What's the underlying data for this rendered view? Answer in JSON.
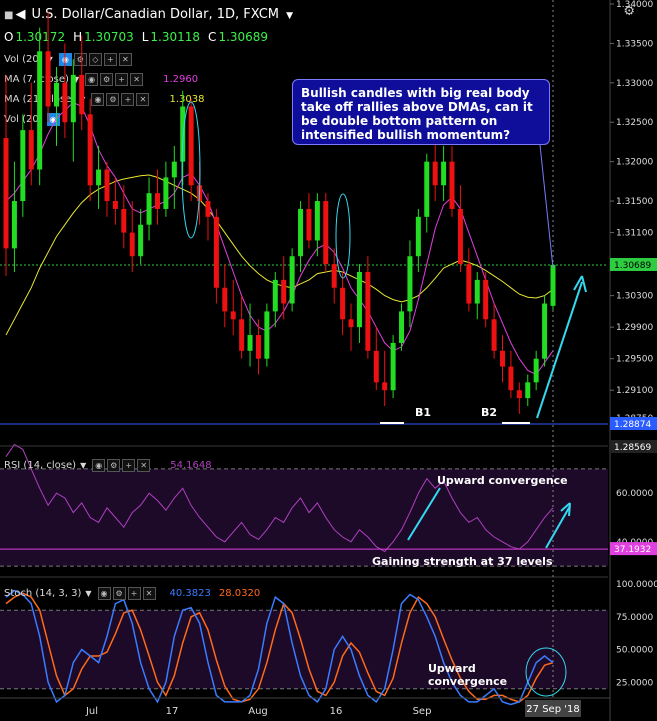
{
  "header": {
    "title": "U.S. Dollar/Canadian Dollar, 1D, FXCM",
    "ohlc": [
      {
        "k": "O",
        "v": "1.30172"
      },
      {
        "k": "H",
        "v": "1.30703"
      },
      {
        "k": "L",
        "v": "1.30118"
      },
      {
        "k": "C",
        "v": "1.30689"
      }
    ]
  },
  "indicators": {
    "vol1": {
      "label": "Vol (20)"
    },
    "ma7": {
      "label": "MA (7, close)",
      "value": "1.2960",
      "color": "#e040e0"
    },
    "ma21": {
      "label": "MA (21, close)",
      "value": "1.3038",
      "color": "#e8e830"
    },
    "vol2": {
      "label": "Vol (20)"
    },
    "rsi": {
      "label": "RSI (14, close)",
      "value": "54.1648"
    },
    "stoch": {
      "label": "Stoch (14, 3, 3)",
      "k": "40.3823",
      "d": "28.0320",
      "k_color": "#3a7bff",
      "d_color": "#ff6a1a"
    }
  },
  "annotations": {
    "callout": "Bullish candles with big real body take off rallies above DMAs, can it be double bottom pattern on intensified bullish momentum?",
    "b1": "B1",
    "b2": "B2",
    "rsi_up": "Upward convergence",
    "rsi_strength": "Gaining strength at 37 levels",
    "stoch_up_1": "Upward",
    "stoch_up_2": "convergence"
  },
  "axis": {
    "price_ticks": [
      "1.34000",
      "1.33500",
      "1.33000",
      "1.32500",
      "1.32000",
      "1.31500",
      "1.31100",
      "1.30700",
      "1.30300",
      "1.29900",
      "1.29500",
      "1.29100",
      "1.28750"
    ],
    "price_badge_green": "1.30689",
    "price_badge_blue": "1.28874",
    "price_badge_low": "1.28569",
    "rsi_ticks": [
      "60.0000",
      "40.0000"
    ],
    "rsi_badge": "37.1932",
    "stoch_ticks": [
      "100.0000",
      "75.0000",
      "50.0000",
      "25.0000"
    ],
    "x_labels": [
      "Jul",
      "17",
      "Aug",
      "16",
      "Sep"
    ],
    "crosshair_date": "27 Sep '18"
  },
  "colors": {
    "bull": "#22dd22",
    "bear": "#ee1111",
    "ma7": "#e040e0",
    "ma21": "#e8e830",
    "rsi": "#b040c0",
    "highlight": "#34d8f0"
  },
  "chart_data": {
    "type": "candlestick",
    "y_unit": "USD/CAD",
    "ylim": [
      1.2857,
      1.34
    ],
    "candles": [
      [
        1.323,
        1.331,
        1.3055,
        1.309
      ],
      [
        1.309,
        1.32,
        1.306,
        1.315
      ],
      [
        1.315,
        1.326,
        1.313,
        1.324
      ],
      [
        1.324,
        1.33,
        1.317,
        1.319
      ],
      [
        1.319,
        1.337,
        1.317,
        1.334
      ],
      [
        1.334,
        1.339,
        1.325,
        1.327
      ],
      [
        1.327,
        1.332,
        1.322,
        1.33
      ],
      [
        1.33,
        1.335,
        1.323,
        1.325
      ],
      [
        1.325,
        1.333,
        1.32,
        1.331
      ],
      [
        1.331,
        1.336,
        1.324,
        1.326
      ],
      [
        1.326,
        1.328,
        1.315,
        1.317
      ],
      [
        1.317,
        1.322,
        1.314,
        1.319
      ],
      [
        1.319,
        1.32,
        1.313,
        1.315
      ],
      [
        1.315,
        1.318,
        1.312,
        1.314
      ],
      [
        1.314,
        1.317,
        1.309,
        1.311
      ],
      [
        1.311,
        1.315,
        1.306,
        1.308
      ],
      [
        1.308,
        1.314,
        1.307,
        1.312
      ],
      [
        1.312,
        1.318,
        1.31,
        1.316
      ],
      [
        1.316,
        1.319,
        1.312,
        1.314
      ],
      [
        1.314,
        1.32,
        1.313,
        1.318
      ],
      [
        1.318,
        1.322,
        1.314,
        1.32
      ],
      [
        1.32,
        1.329,
        1.317,
        1.327
      ],
      [
        1.327,
        1.328,
        1.315,
        1.317
      ],
      [
        1.317,
        1.32,
        1.312,
        1.315
      ],
      [
        1.315,
        1.316,
        1.31,
        1.313
      ],
      [
        1.313,
        1.314,
        1.302,
        1.304
      ],
      [
        1.304,
        1.307,
        1.299,
        1.301
      ],
      [
        1.301,
        1.305,
        1.298,
        1.3
      ],
      [
        1.3,
        1.303,
        1.295,
        1.296
      ],
      [
        1.296,
        1.302,
        1.294,
        1.298
      ],
      [
        1.298,
        1.3,
        1.293,
        1.295
      ],
      [
        1.295,
        1.302,
        1.294,
        1.301
      ],
      [
        1.301,
        1.306,
        1.299,
        1.305
      ],
      [
        1.305,
        1.308,
        1.3,
        1.302
      ],
      [
        1.302,
        1.309,
        1.301,
        1.308
      ],
      [
        1.308,
        1.315,
        1.306,
        1.314
      ],
      [
        1.314,
        1.316,
        1.309,
        1.31
      ],
      [
        1.31,
        1.316,
        1.308,
        1.315
      ],
      [
        1.315,
        1.316,
        1.306,
        1.307
      ],
      [
        1.307,
        1.309,
        1.302,
        1.304
      ],
      [
        1.304,
        1.306,
        1.298,
        1.3
      ],
      [
        1.3,
        1.302,
        1.296,
        1.299
      ],
      [
        1.299,
        1.307,
        1.297,
        1.306
      ],
      [
        1.306,
        1.308,
        1.295,
        1.296
      ],
      [
        1.296,
        1.299,
        1.291,
        1.292
      ],
      [
        1.292,
        1.296,
        1.289,
        1.291
      ],
      [
        1.291,
        1.298,
        1.29,
        1.297
      ],
      [
        1.297,
        1.302,
        1.296,
        1.301
      ],
      [
        1.301,
        1.31,
        1.299,
        1.308
      ],
      [
        1.308,
        1.314,
        1.306,
        1.313
      ],
      [
        1.313,
        1.321,
        1.311,
        1.32
      ],
      [
        1.32,
        1.323,
        1.315,
        1.317
      ],
      [
        1.317,
        1.322,
        1.315,
        1.32
      ],
      [
        1.32,
        1.322,
        1.313,
        1.314
      ],
      [
        1.314,
        1.317,
        1.306,
        1.307
      ],
      [
        1.307,
        1.309,
        1.301,
        1.302
      ],
      [
        1.302,
        1.306,
        1.3,
        1.305
      ],
      [
        1.305,
        1.306,
        1.299,
        1.3
      ],
      [
        1.3,
        1.302,
        1.295,
        1.296
      ],
      [
        1.296,
        1.298,
        1.292,
        1.294
      ],
      [
        1.294,
        1.296,
        1.29,
        1.291
      ],
      [
        1.291,
        1.292,
        1.288,
        1.29
      ],
      [
        1.29,
        1.293,
        1.289,
        1.292
      ],
      [
        1.292,
        1.296,
        1.291,
        1.295
      ],
      [
        1.295,
        1.303,
        1.294,
        1.302
      ],
      [
        1.3017,
        1.307,
        1.3012,
        1.3069
      ]
    ],
    "ma7": [
      1.315,
      1.316,
      1.3175,
      1.319,
      1.321,
      1.3235,
      1.3255,
      1.3265,
      1.3275,
      1.327,
      1.3245,
      1.3215,
      1.3195,
      1.318,
      1.316,
      1.314,
      1.3135,
      1.314,
      1.3145,
      1.315,
      1.316,
      1.318,
      1.3185,
      1.317,
      1.315,
      1.312,
      1.309,
      1.306,
      1.303,
      1.3005,
      1.299,
      1.2985,
      1.2995,
      1.301,
      1.303,
      1.3055,
      1.3075,
      1.309,
      1.3095,
      1.3085,
      1.3065,
      1.304,
      1.3025,
      1.301,
      1.299,
      1.297,
      1.296,
      1.2965,
      1.2985,
      1.3025,
      1.307,
      1.3115,
      1.3145,
      1.3155,
      1.314,
      1.311,
      1.308,
      1.305,
      1.302,
      1.2995,
      1.297,
      1.295,
      1.2935,
      1.293,
      1.2945,
      1.296
    ],
    "ma21": [
      1.298,
      1.3,
      1.302,
      1.304,
      1.3065,
      1.3085,
      1.3105,
      1.312,
      1.3135,
      1.3148,
      1.3158,
      1.3165,
      1.317,
      1.3175,
      1.3178,
      1.318,
      1.3182,
      1.3183,
      1.318,
      1.3175,
      1.317,
      1.3165,
      1.316,
      1.3152,
      1.314,
      1.3125,
      1.311,
      1.3095,
      1.308,
      1.3068,
      1.3058,
      1.305,
      1.3045,
      1.3042,
      1.304,
      1.3045,
      1.305,
      1.3058,
      1.306,
      1.3062,
      1.306,
      1.3055,
      1.305,
      1.3045,
      1.3038,
      1.303,
      1.3025,
      1.3022,
      1.3025,
      1.303,
      1.304,
      1.3052,
      1.3065,
      1.307,
      1.3075,
      1.3072,
      1.3068,
      1.3062,
      1.3055,
      1.3048,
      1.304,
      1.3032,
      1.3028,
      1.3027,
      1.303,
      1.3038
    ],
    "rsi": [
      75,
      80,
      78,
      70,
      62,
      55,
      60,
      58,
      52,
      56,
      50,
      48,
      54,
      50,
      46,
      52,
      55,
      60,
      57,
      53,
      58,
      62,
      55,
      50,
      46,
      42,
      40,
      44,
      48,
      43,
      41,
      45,
      50,
      48,
      54,
      58,
      52,
      56,
      50,
      45,
      42,
      40,
      45,
      42,
      38,
      36,
      40,
      45,
      52,
      60,
      66,
      62,
      65,
      58,
      52,
      48,
      50,
      45,
      42,
      40,
      38,
      37,
      40,
      45,
      50,
      54
    ],
    "stoch_k": [
      90,
      95,
      92,
      85,
      60,
      25,
      10,
      15,
      40,
      50,
      45,
      40,
      60,
      85,
      88,
      70,
      40,
      20,
      10,
      25,
      60,
      80,
      82,
      70,
      40,
      15,
      10,
      10,
      10,
      15,
      35,
      70,
      90,
      85,
      55,
      30,
      15,
      10,
      20,
      50,
      60,
      50,
      30,
      15,
      10,
      20,
      50,
      85,
      92,
      88,
      75,
      60,
      40,
      25,
      15,
      10,
      10,
      15,
      20,
      10,
      8,
      10,
      25,
      40,
      45,
      40
    ],
    "stoch_d": [
      85,
      90,
      93,
      90,
      80,
      55,
      30,
      15,
      20,
      35,
      45,
      45,
      48,
      62,
      78,
      80,
      65,
      45,
      25,
      15,
      30,
      55,
      75,
      78,
      65,
      42,
      22,
      12,
      10,
      12,
      20,
      40,
      65,
      85,
      78,
      58,
      35,
      18,
      15,
      25,
      45,
      55,
      48,
      32,
      18,
      15,
      28,
      55,
      78,
      90,
      85,
      75,
      58,
      42,
      28,
      18,
      12,
      12,
      15,
      15,
      12,
      10,
      15,
      28,
      38,
      40
    ]
  }
}
